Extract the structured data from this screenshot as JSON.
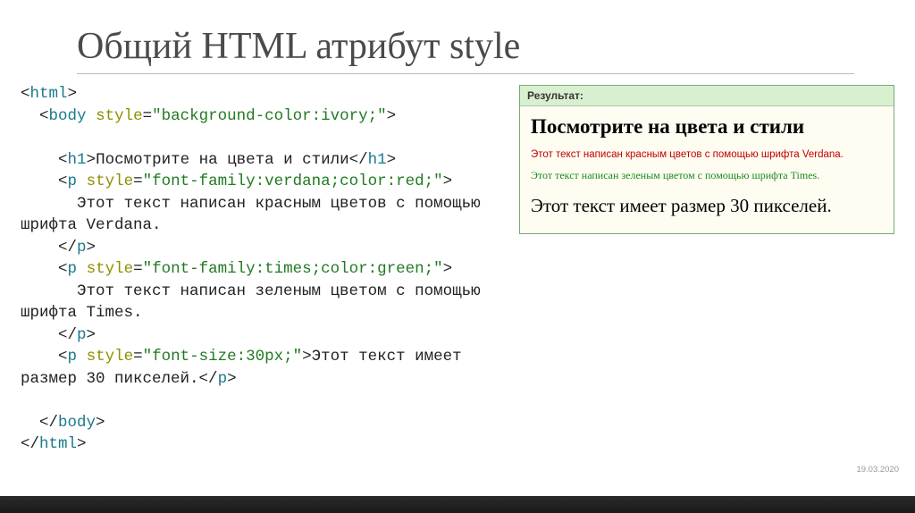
{
  "slide": {
    "title": "Общий HTML атрибут style",
    "date": "19.03.2020"
  },
  "code": {
    "l01_open": "<",
    "l01_tag": "html",
    "l01_close": ">",
    "l02_indent": "  ",
    "l02_open": "<",
    "l02_tag": "body",
    "l02_sp": " ",
    "l02_attr": "style",
    "l02_eq": "=",
    "l02_str": "\"background-color:ivory;\"",
    "l02_close": ">",
    "l04_indent": "    ",
    "l04_open": "<",
    "l04_tag": "h1",
    "l04_close": ">",
    "l04_txt": "Посмотрите на цвета и стили",
    "l04_open2": "</",
    "l04_tag2": "h1",
    "l04_close2": ">",
    "l05_indent": "    ",
    "l05_open": "<",
    "l05_tag": "p",
    "l05_sp": " ",
    "l05_attr": "style",
    "l05_eq": "=",
    "l05_str": "\"font-family:verdana;color:red;\"",
    "l05_close": ">",
    "l06_txt": "      Этот текст написан красным цветов с помощью\nшрифта Verdana.",
    "l07_indent": "    ",
    "l07_open": "</",
    "l07_tag": "p",
    "l07_close": ">",
    "l08_indent": "    ",
    "l08_open": "<",
    "l08_tag": "p",
    "l08_sp": " ",
    "l08_attr": "style",
    "l08_eq": "=",
    "l08_str": "\"font-family:times;color:green;\"",
    "l08_close": ">",
    "l09_txt": "      Этот текст написан зеленым цветом с помощью\nшрифта Times.",
    "l10_indent": "    ",
    "l10_open": "</",
    "l10_tag": "p",
    "l10_close": ">",
    "l11_indent": "    ",
    "l11_open": "<",
    "l11_tag": "p",
    "l11_sp": " ",
    "l11_attr": "style",
    "l11_eq": "=",
    "l11_str": "\"font-size:30px;\"",
    "l11_close": ">",
    "l11_txt": "Этот текст имеет\nразмер 30 пикселей.",
    "l11_open2": "</",
    "l11_tag2": "p",
    "l11_close2": ">",
    "l13_indent": "  ",
    "l13_open": "</",
    "l13_tag": "body",
    "l13_close": ">",
    "l14_open": "</",
    "l14_tag": "html",
    "l14_close": ">"
  },
  "result": {
    "header": "Результат:",
    "heading": "Посмотрите на цвета и стили",
    "p_red": "Этот текст написан красным цветов с помощью шрифта Verdana.",
    "p_green": "Этот текст написан зеленым цветом с помощью шрифта Times.",
    "p_big": "Этот текст имеет размер 30 пикселей."
  }
}
